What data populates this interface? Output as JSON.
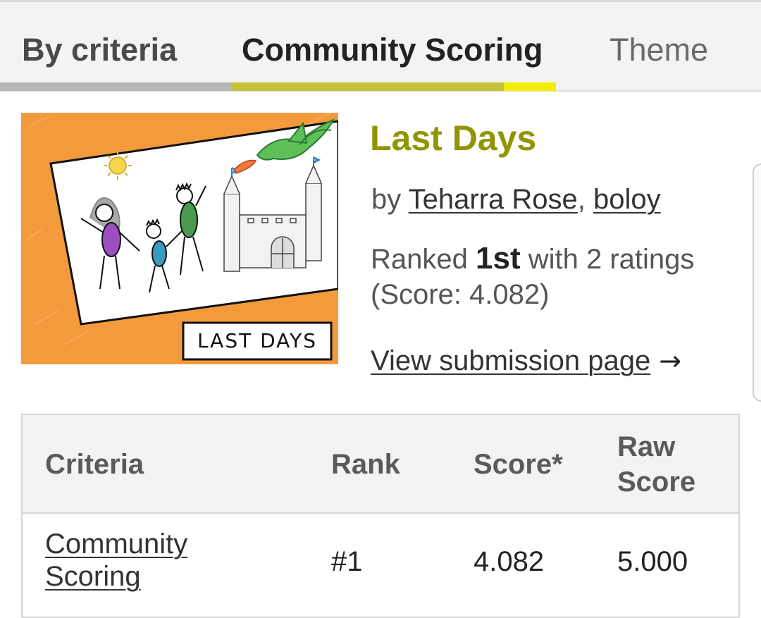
{
  "tabs": [
    {
      "label": "By criteria"
    },
    {
      "label": "Community Scoring"
    },
    {
      "label": "Theme"
    }
  ],
  "entry": {
    "title": "Last Days",
    "by_prefix": "by",
    "authors": [
      "Teharra Rose",
      "boloy"
    ],
    "author_separator": ",",
    "ranked_prefix": "Ranked",
    "rank": "1st",
    "ratings_text": "with 2 ratings",
    "score_text": "(Score: 4.082)",
    "view_link": "View submission page",
    "arrow": "→",
    "cover_caption": "LAST DAYS"
  },
  "table": {
    "headers": {
      "criteria": "Criteria",
      "rank": "Rank",
      "score": "Score*",
      "raw_line1": "Raw",
      "raw_line2": "Score"
    },
    "rows": [
      {
        "criteria_line1": "Community",
        "criteria_line2": "Scoring",
        "rank": "#1",
        "score": "4.082",
        "raw": "5.000"
      }
    ]
  },
  "colors": {
    "accent_title": "#929400",
    "tab_underline_active": "#c5c13c",
    "tab_underline_highlight": "#f4ef00",
    "cover_background": "#f39a3c"
  }
}
